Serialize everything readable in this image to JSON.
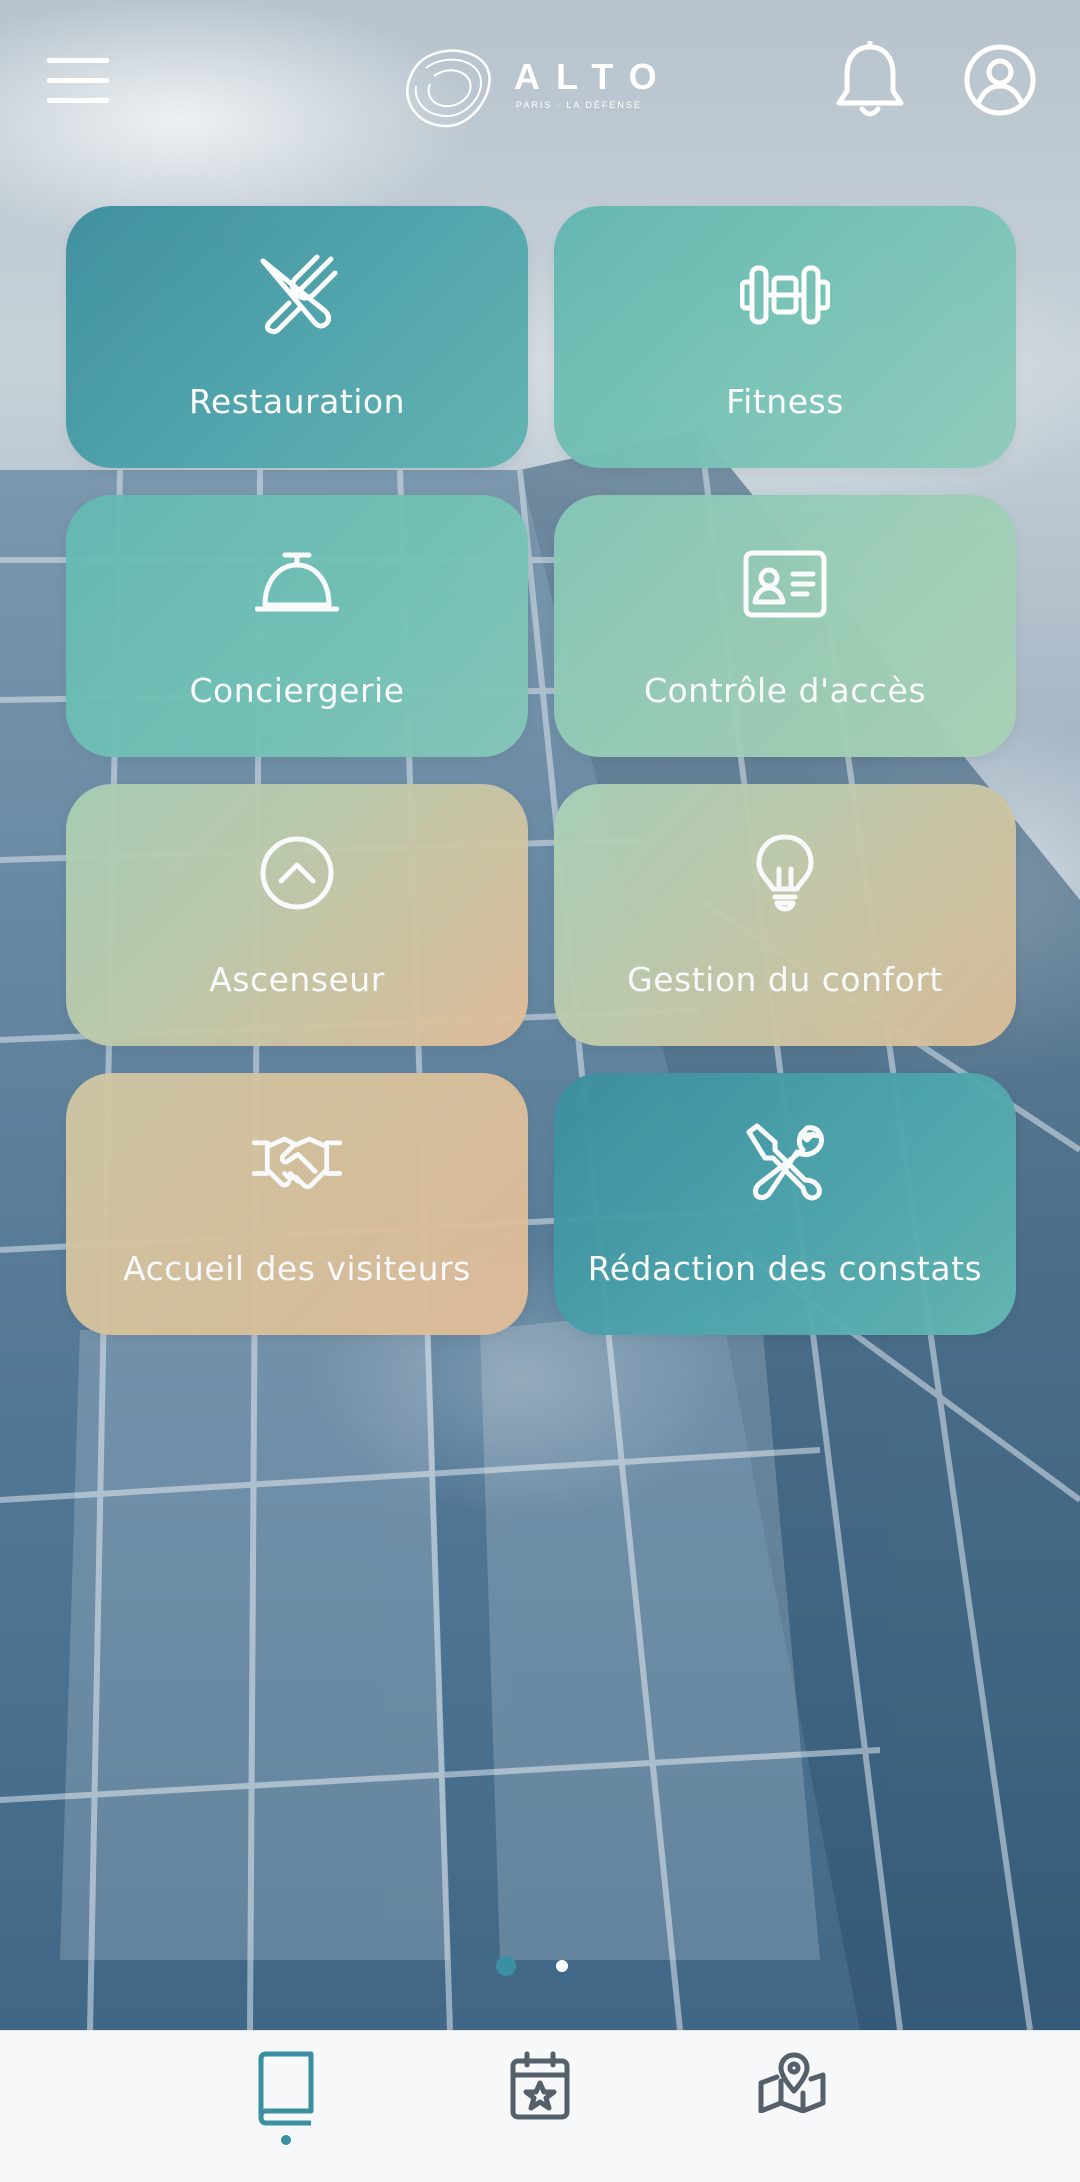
{
  "app": {
    "logo_word": "ALTO",
    "logo_subtitle": "PARIS · LA DÉFENSE"
  },
  "header": {
    "menu_icon": "hamburger-menu-icon",
    "notification_icon": "bell-icon",
    "profile_icon": "user-circle-icon"
  },
  "tiles": [
    {
      "label": "Restauration",
      "icon": "fork-knife-icon"
    },
    {
      "label": "Fitness",
      "icon": "dumbbell-icon"
    },
    {
      "label": "Conciergerie",
      "icon": "service-bell-icon"
    },
    {
      "label": "Contrôle d'accès",
      "icon": "id-card-icon"
    },
    {
      "label": "Ascenseur",
      "icon": "chevron-up-circle-icon"
    },
    {
      "label": "Gestion du confort",
      "icon": "lightbulb-icon"
    },
    {
      "label": "Accueil des visiteurs",
      "icon": "handshake-icon"
    },
    {
      "label": "Rédaction des constats",
      "icon": "wrench-screwdriver-icon"
    }
  ],
  "pager": {
    "pages": 2,
    "active": 1
  },
  "bottom_nav": {
    "items": [
      {
        "icon": "book-icon",
        "active": true
      },
      {
        "icon": "calendar-star-icon",
        "active": false
      },
      {
        "icon": "map-pin-icon",
        "active": false
      }
    ]
  },
  "colors": {
    "accent": "#3a8fa0",
    "tile_teal": "#4fa5ac",
    "tile_sand": "#e0bc98",
    "nav_icon": "#55606a"
  }
}
